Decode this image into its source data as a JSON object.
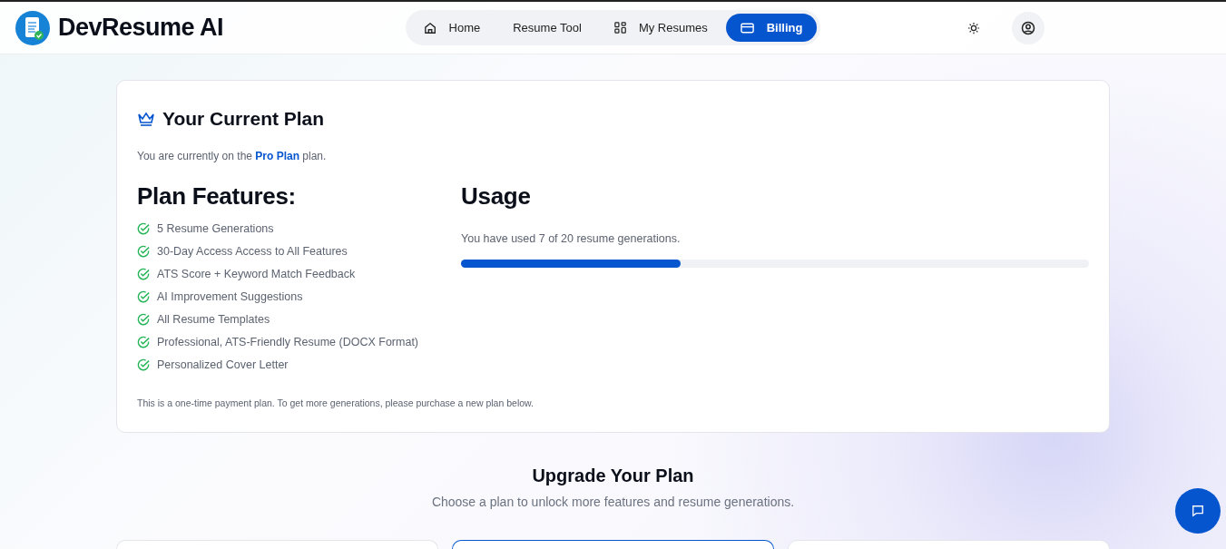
{
  "brand": {
    "name": "DevResume AI"
  },
  "nav": [
    {
      "label": "Home",
      "selected": false
    },
    {
      "label": "Resume Tool",
      "selected": false
    },
    {
      "label": "My Resumes",
      "selected": false
    },
    {
      "label": "Billing",
      "selected": true
    }
  ],
  "current_plan": {
    "title": "Your Current Plan",
    "intro": "You are currently on the **Pro Plan** plan.",
    "features_title": "Plan Features:",
    "features": [
      "5 Resume Generations",
      "30-Day Access Access to All Features",
      "ATS Score + Keyword Match Feedback",
      "AI Improvement Suggestions",
      "All Resume Templates",
      "Professional, ATS-Friendly Resume (DOCX Format)",
      "Personalized Cover Letter"
    ],
    "note": "This is a one-time payment plan. To get more generations, please purchase a new plan below.",
    "usage_title": "Usage",
    "usage_text": "You have used 7 of 20 resume generations.",
    "level": 0.35
  },
  "upgrade": {
    "title": "Upgrade Your Plan",
    "subtitle": "Choose a plan to unlock more features and resume generations.",
    "plans": [
      {
        "selected": false
      },
      {
        "selected": true
      },
      {
        "selected": false
      }
    ]
  }
}
